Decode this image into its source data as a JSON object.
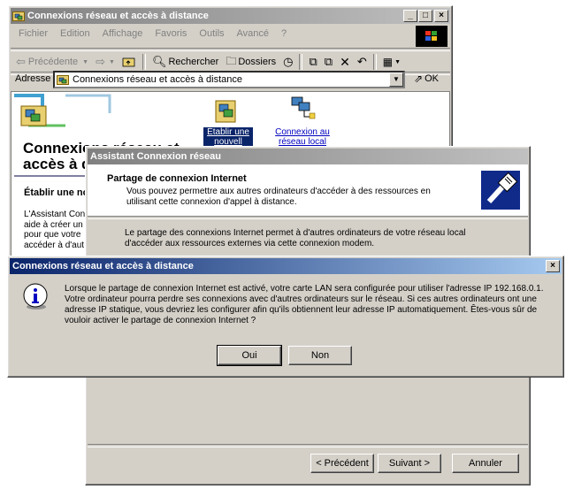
{
  "explorer": {
    "title": "Connexions réseau et accès à distance",
    "menu": [
      "Fichier",
      "Edition",
      "Affichage",
      "Favoris",
      "Outils",
      "Avancé",
      "?"
    ],
    "toolbar": {
      "back": "Précédente",
      "search": "Rechercher",
      "folders": "Dossiers"
    },
    "address_label": "Adresse",
    "address_value": "Connexions réseau et accès à distance",
    "go_label": "OK",
    "heading_line1": "Connexions réseau et",
    "heading_line2": "accès à d",
    "section_title": "Établir une no",
    "section_text": [
      "L'Assistant Con",
      "aide à créer un",
      "pour que votre",
      "accéder à d'aut"
    ],
    "icon1_label_line1": "Établir une",
    "icon1_label_line2": "nouvell",
    "icon2_label_line1": "Connexion au",
    "icon2_label_line2": "réseau local"
  },
  "wizard": {
    "title": "Assistant Connexion réseau",
    "header_title": "Partage de connexion Internet",
    "header_text": "Vous pouvez permettre aux autres ordinateurs d'accéder à des ressources en utilisant cette connexion d'appel à distance.",
    "body_text": "Le partage des connexions Internet permet à d'autres ordinateurs de votre réseau local d'accéder aux ressources externes via cette connexion modem.",
    "back_btn": "< Précédent",
    "next_btn": "Suivant >",
    "cancel_btn": "Annuler"
  },
  "dialog": {
    "title": "Connexions réseau et accès à distance",
    "message": "Lorsque le partage de connexion Internet est activé, votre carte LAN sera configurée pour utiliser l'adresse IP 192.168.0.1. Votre ordinateur pourra perdre ses connexions avec d'autres ordinateurs sur le réseau. Si ces autres ordinateurs ont une adresse IP statique, vous devriez les configurer afin qu'ils obtiennent leur adresse IP automatiquement. Êtes-vous sûr de vouloir activer le partage de connexion Internet ?",
    "yes_btn": "Oui",
    "no_btn": "Non"
  }
}
